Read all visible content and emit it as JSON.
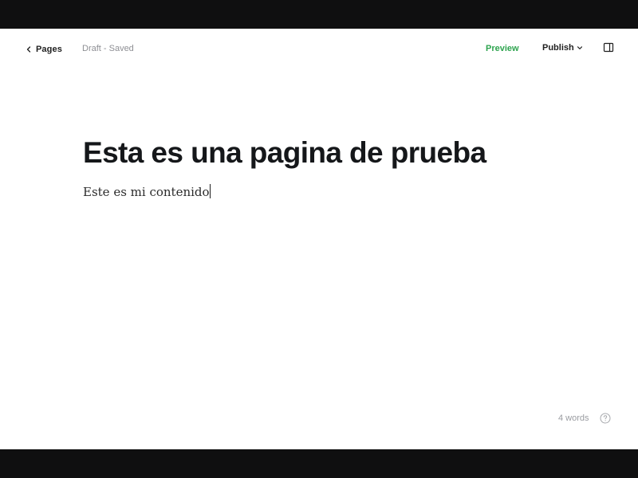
{
  "header": {
    "back_label": "Pages",
    "status": "Draft - Saved",
    "preview_label": "Preview",
    "publish_label": "Publish"
  },
  "post": {
    "title": "Esta es una pagina de prueba",
    "body": "Este es mi contenido"
  },
  "footer": {
    "word_count": "4 words"
  },
  "icons": {
    "back": "chevron-left-icon",
    "publish_caret": "chevron-down-icon",
    "sidebar": "sidebar-panel-icon",
    "help": "question-circle-icon"
  },
  "colors": {
    "accent_preview": "#2ea44f",
    "text_primary": "#15171a",
    "text_muted": "#8e8f94",
    "frame_background": "#0f0f10"
  }
}
